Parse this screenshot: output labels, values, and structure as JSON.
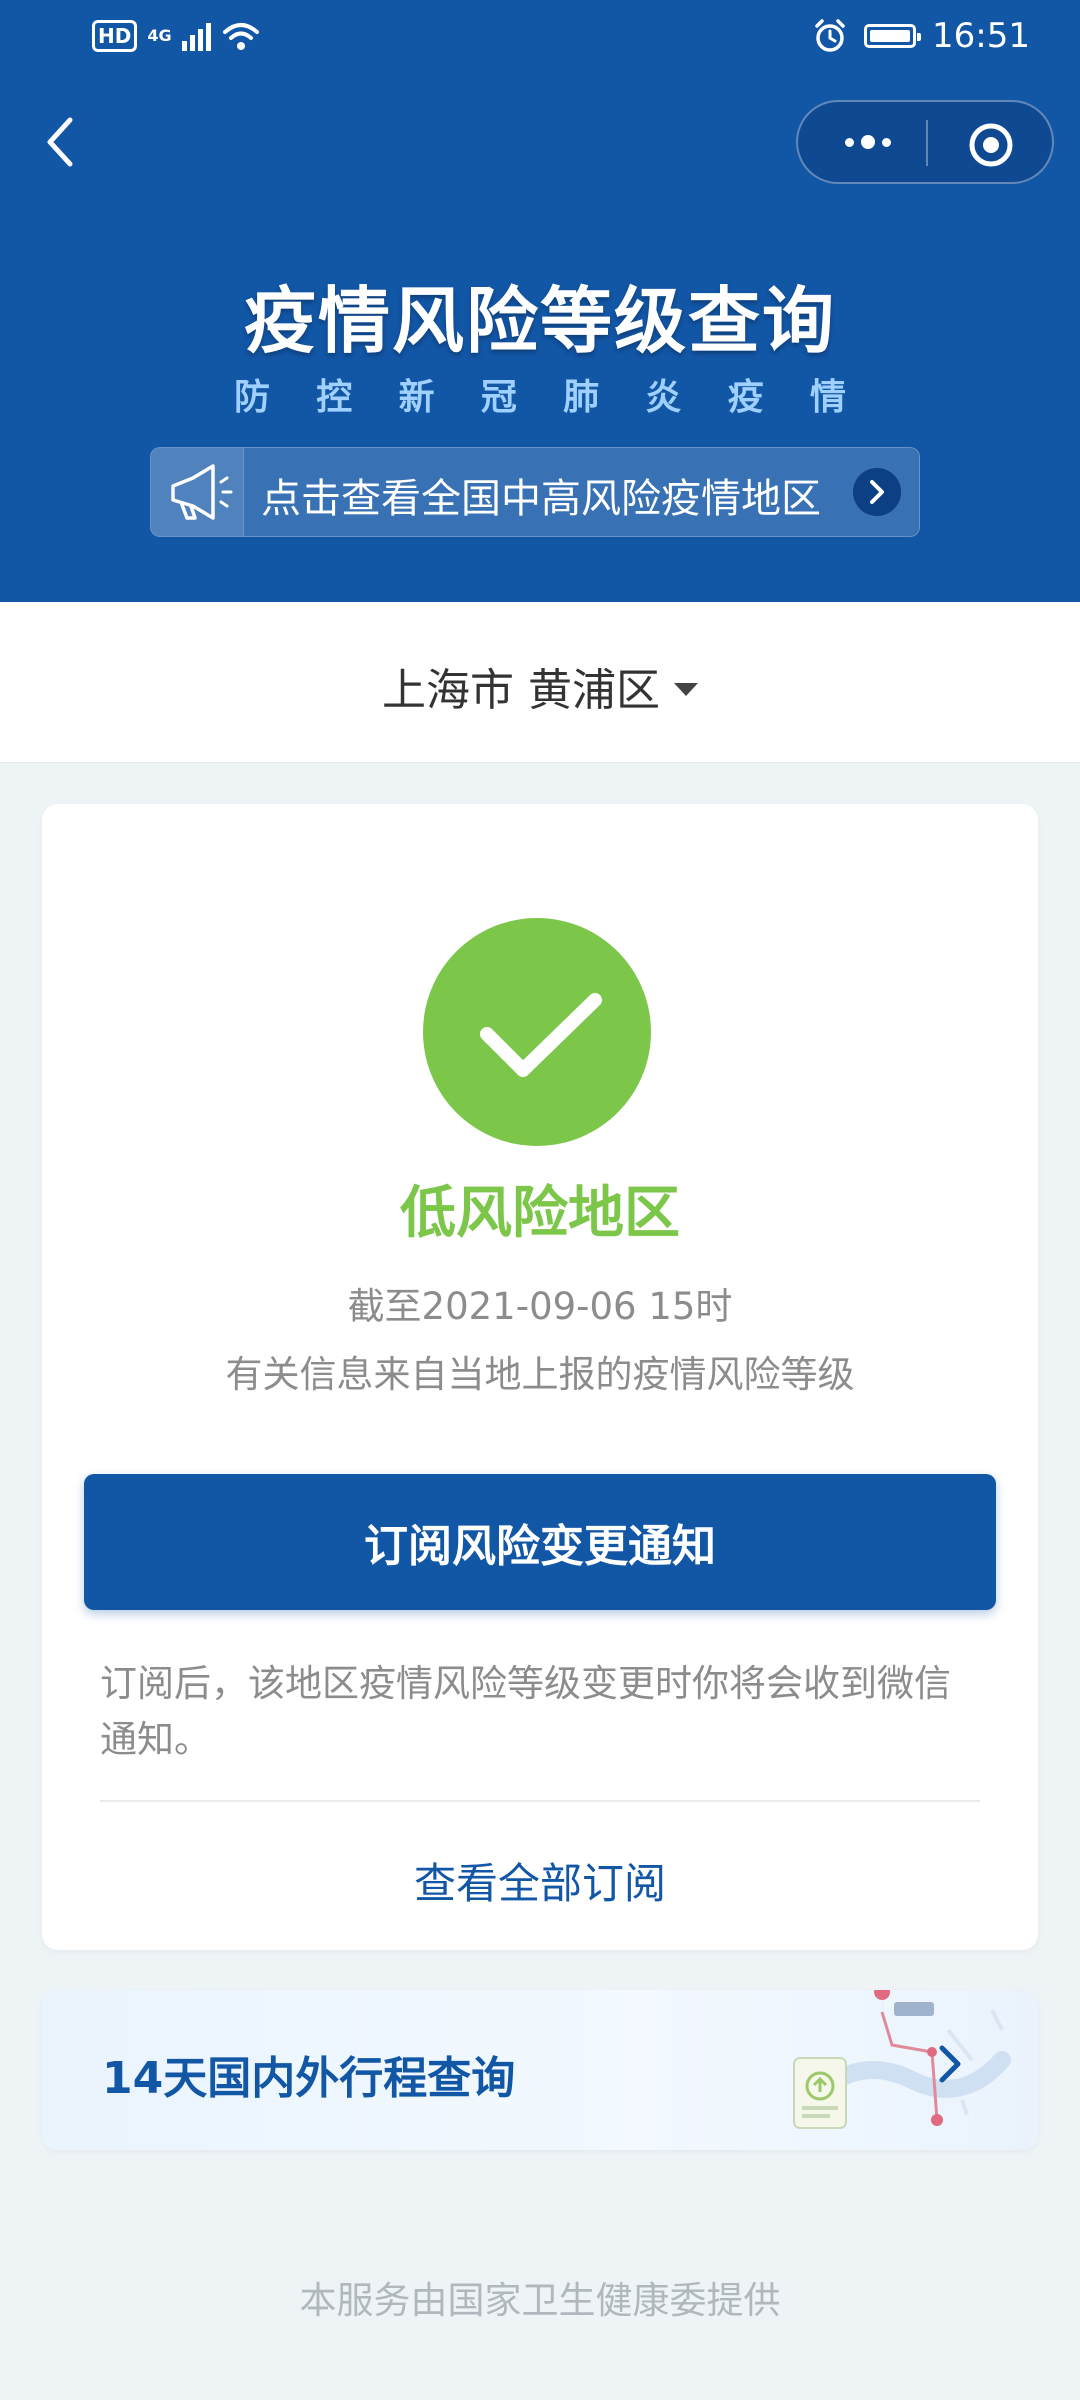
{
  "status_bar": {
    "hd": "HD",
    "network": "4G",
    "time": "16:51"
  },
  "nav": {
    "back_icon": "chevron-left-icon",
    "more_icon": "more-dots-icon",
    "close_icon": "target-circle-icon"
  },
  "header": {
    "title": "疫情风险等级查询",
    "subtitle_chars": [
      "防",
      "控",
      "新",
      "冠",
      "肺",
      "炎",
      "疫",
      "情"
    ],
    "notice_text": "点击查看全国中高风险疫情地区",
    "notice_icon": "megaphone-icon"
  },
  "location": {
    "label": "上海市 黄浦区"
  },
  "risk_card": {
    "level": "低风险地区",
    "update_time": "截至2021-09-06 15时",
    "source_info": "有关信息来自当地上报的疫情风险等级",
    "subscribe_label": "订阅风险变更通知",
    "subscribe_note": "订阅后，该地区疫情风险等级变更时你将会收到微信通知。",
    "view_all_label": "查看全部订阅"
  },
  "itinerary": {
    "title": "14天国内外行程查询"
  },
  "footer": {
    "text": "本服务由国家卫生健康委提供"
  },
  "colors": {
    "brand_blue": "#1256a6",
    "low_risk_green": "#7cc64a",
    "background": "#eef3f6"
  }
}
